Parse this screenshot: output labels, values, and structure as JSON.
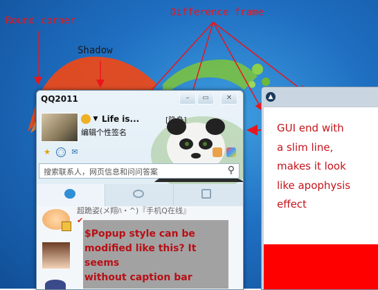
{
  "annotations": {
    "round_corner": "Round corner",
    "shadow": "Shadow",
    "difference_frame": "Difference frame"
  },
  "qq_window": {
    "title": "QQ2011",
    "nickname": "Life is...",
    "hidden_status": "[隐身]",
    "signature": "编辑个性签名",
    "search_placeholder": "搜索联系人，网页信息和问问答案",
    "contact_1_text": "超跪姿(メ翔ﾊ・^)『手机Q在线』"
  },
  "popup": {
    "line_1": "$Popup style can be",
    "line_2": "modified like this? It seems",
    "line_3": "without caption bar"
  },
  "right_window": {
    "line_1": "GUI end with",
    "line_2": "a slim line,",
    "line_3": "makes it look",
    "line_4": "like apophysis",
    "line_5": "effect"
  },
  "colors": {
    "annotation": "#e8161c",
    "popup_text": "#b70f15",
    "red_panel": "#ff0000"
  }
}
